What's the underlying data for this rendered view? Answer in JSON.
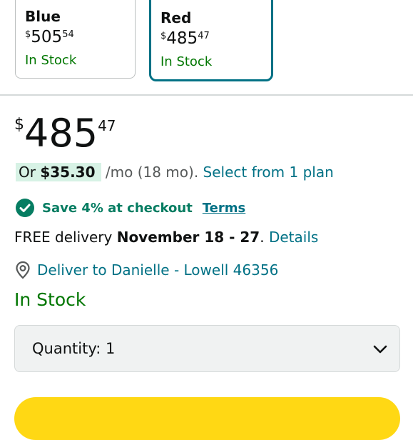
{
  "variants": [
    {
      "name": "Blue",
      "currency": "$",
      "price_whole": "505",
      "price_fraction": "54",
      "stock": "In Stock"
    },
    {
      "name": "Red",
      "currency": "$",
      "price_whole": "485",
      "price_fraction": "47",
      "stock": "In Stock",
      "selected": true
    }
  ],
  "price": {
    "currency": "$",
    "whole": "485",
    "fraction": "47"
  },
  "financing": {
    "prefix": "Or",
    "amount": "$35.30",
    "term": "/mo (18 mo).",
    "link": "Select from 1 plan"
  },
  "savings": {
    "text": "Save 4% at checkout",
    "terms_link": "Terms"
  },
  "delivery": {
    "prefix": "FREE delivery",
    "dates": "November 18 - 27",
    "sep": ".",
    "details_link": "Details"
  },
  "deliver_to": {
    "text": "Deliver to Danielle - Lowell 46356"
  },
  "availability": "In Stock",
  "quantity": {
    "label": "Quantity:",
    "value": "1"
  },
  "colors": {
    "link": "#007185",
    "stock_green": "#007600",
    "selected_border": "#007185",
    "buy_button": "#ffd814",
    "savings_green": "#067d62"
  }
}
